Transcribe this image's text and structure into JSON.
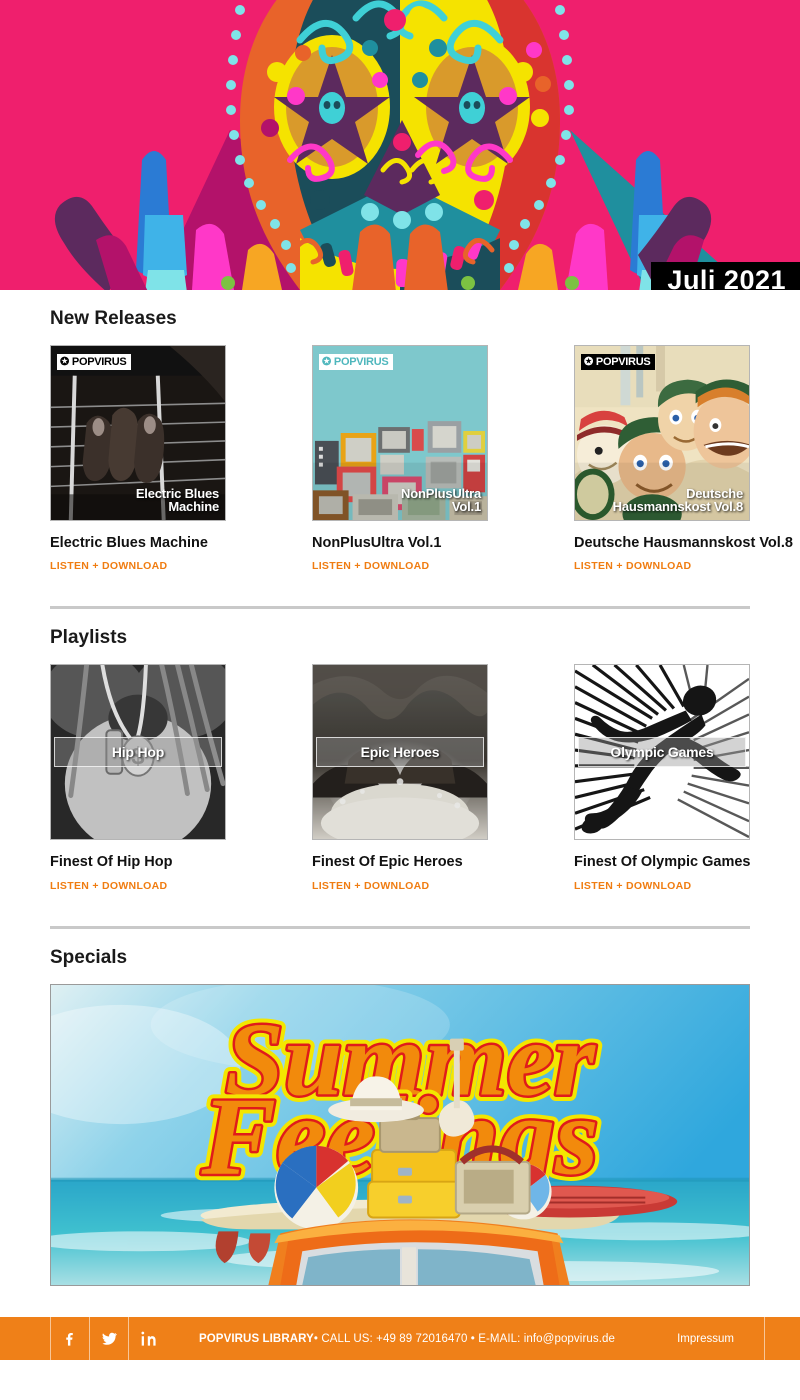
{
  "hero": {
    "badge_label": "Juli 2021",
    "background_color": "#ef1f6d",
    "artwork_name": "sugar-skull-artwork"
  },
  "sections": [
    {
      "key": "new_releases",
      "title": "New Releases",
      "items": [
        {
          "title": "Electric Blues Machine",
          "link_label": "LISTEN + DOWNLOAD",
          "cover_caption_line1": "Electric Blues",
          "cover_caption_line2": "Machine",
          "logo_label": "POPVIRUS",
          "logo_bg": "#ffffff",
          "logo_fg": "#000000",
          "cover_art": "electric-blues-machine-cover"
        },
        {
          "title": "NonPlusUltra Vol.1",
          "link_label": "LISTEN + DOWNLOAD",
          "cover_caption_line1": "NonPlusUltra",
          "cover_caption_line2": "Vol.1",
          "logo_label": "POPVIRUS",
          "logo_bg": "#ffffff",
          "logo_fg": "#4fb7bd",
          "cover_art": "nonplusultra-vol1-cover"
        },
        {
          "title": "Deutsche Hausmannskost Vol.8",
          "link_label": "LISTEN + DOWNLOAD",
          "cover_caption_line1": "Deutsche",
          "cover_caption_line2": "Hausmannskost Vol.8",
          "logo_label": "POPVIRUS",
          "logo_bg": "#000000",
          "logo_fg": "#ffffff",
          "cover_art": "deutsche-hausmannskost-vol8-cover"
        }
      ]
    },
    {
      "key": "playlists",
      "title": "Playlists",
      "items": [
        {
          "title": "Finest Of Hip Hop",
          "link_label": "LISTEN + DOWNLOAD",
          "overlay_label": "Hip Hop",
          "cover_art": "hip-hop-playlist-cover"
        },
        {
          "title": "Finest Of Epic Heroes",
          "link_label": "LISTEN + DOWNLOAD",
          "overlay_label": "Epic Heroes",
          "cover_art": "epic-heroes-playlist-cover"
        },
        {
          "title": "Finest Of Olympic Games",
          "link_label": "LISTEN + DOWNLOAD",
          "overlay_label": "Olympic Games",
          "cover_art": "olympic-games-playlist-cover"
        }
      ]
    }
  ],
  "specials": {
    "title": "Specials",
    "banner_title_line1": "Summer",
    "banner_title_line2": "Feelings",
    "banner_art": "summer-feelings-banner"
  },
  "footer": {
    "background_color": "#ef8018",
    "social": [
      {
        "name": "facebook-icon",
        "label": "Facebook"
      },
      {
        "name": "twitter-icon",
        "label": "Twitter"
      },
      {
        "name": "linkedin-icon",
        "label": "LinkedIn"
      }
    ],
    "brand": "POPVIRUS LIBRARY",
    "contact": " • CALL US: +49 89 72016470 • E-MAIL: info@popvirus.de",
    "impressum_label": "Impressum"
  },
  "theme": {
    "accent_orange": "#f07d12",
    "footer_orange": "#ef8018",
    "hero_pink": "#ef1f6d",
    "divider_gray": "#c9c9c9"
  }
}
